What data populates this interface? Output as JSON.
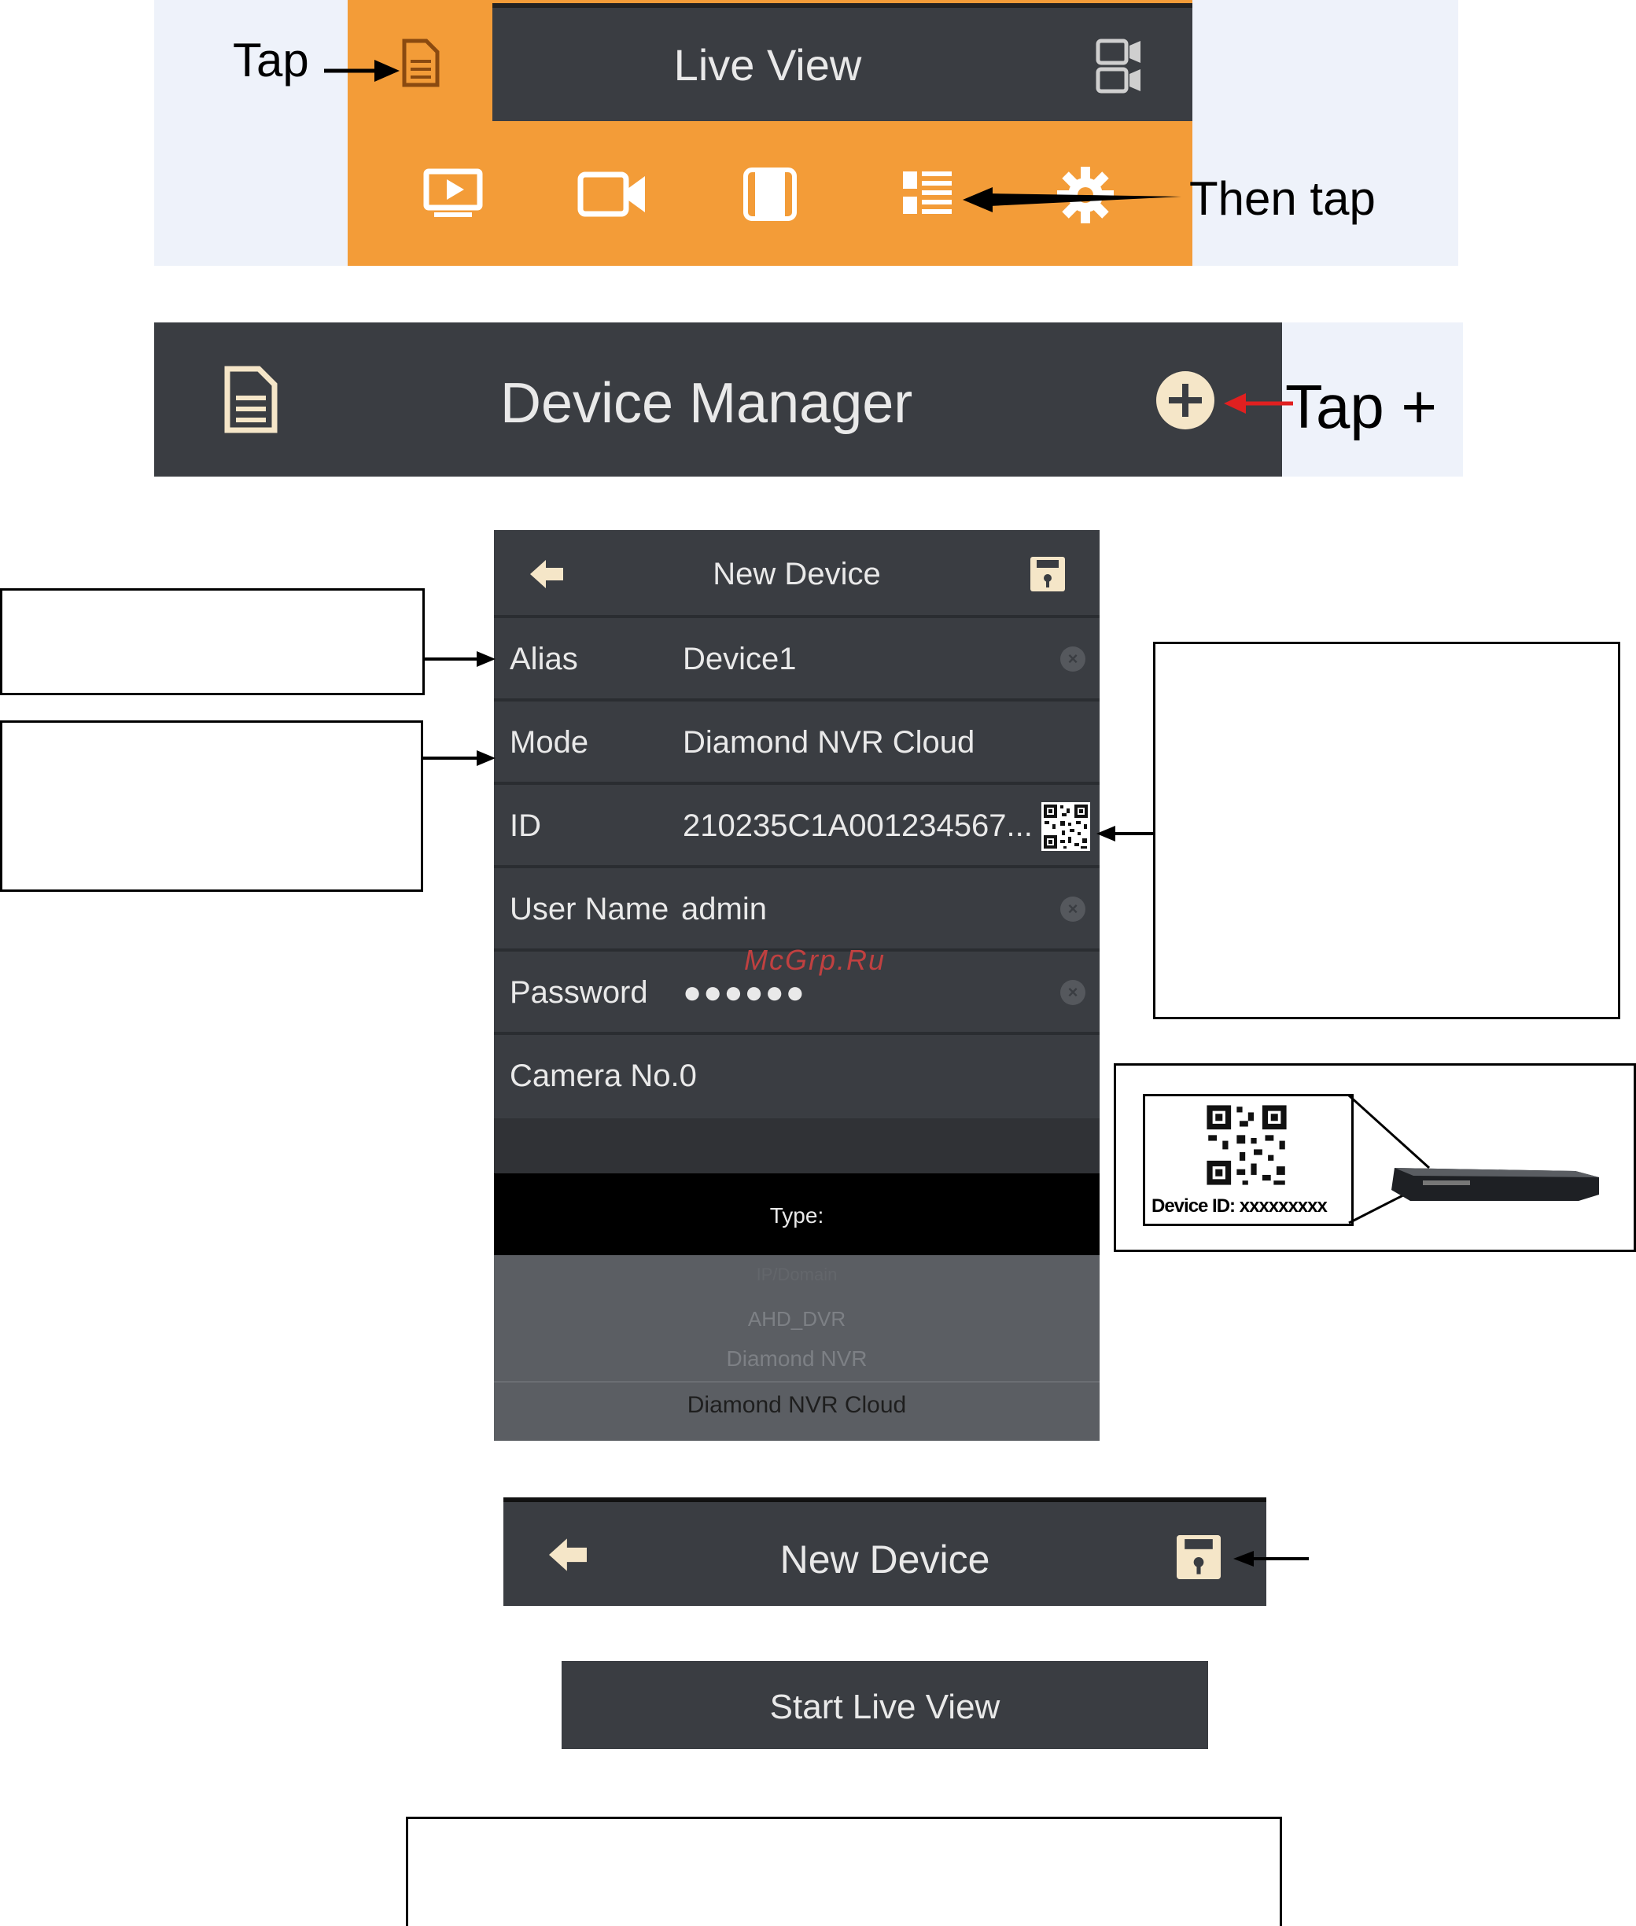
{
  "colors": {
    "orange": "#f39c38",
    "dark": "#3a3d42",
    "cream": "#f5e6c8",
    "pale_blue": "#eef2fa",
    "annot_red": "#e02020"
  },
  "step1": {
    "tap_label": "Tap",
    "title": "Live View",
    "then_tap_label": "Then tap",
    "icons": [
      "document-icon",
      "playback-icon",
      "camera-icon",
      "split-view-icon",
      "device-list-icon",
      "settings-icon",
      "camera-switch-icon"
    ]
  },
  "step2": {
    "title": "Device Manager",
    "tap_plus_label": "Tap +"
  },
  "new_device_form": {
    "title": "New Device",
    "fields": [
      {
        "label": "Alias",
        "value": "Device1"
      },
      {
        "label": "Mode",
        "value": "Diamond NVR Cloud"
      },
      {
        "label": "ID",
        "value": "210235C1A001234567..."
      },
      {
        "label": "User Name",
        "value": "admin"
      },
      {
        "label": "Password",
        "value": "●●●●●●"
      },
      {
        "label": "Camera No.",
        "value": "0"
      }
    ],
    "type_label": "Type:",
    "type_options": [
      "IP/Domain",
      "AHD_DVR",
      "Diamond NVR",
      "Diamond NVR Cloud"
    ],
    "selected_type": "Diamond NVR Cloud"
  },
  "watermark": "McGrp.Ru",
  "device_label": {
    "text": "Device ID: xxxxxxxxx"
  },
  "step4": {
    "title": "New Device"
  },
  "start_button": {
    "label": "Start Live View"
  }
}
